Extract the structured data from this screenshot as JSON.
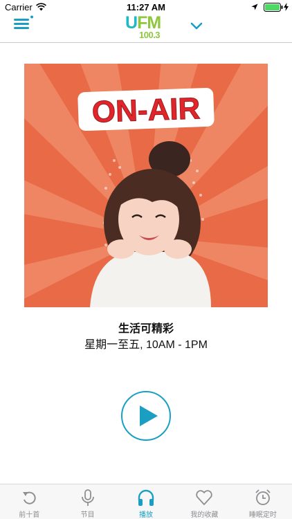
{
  "status_bar": {
    "carrier": "Carrier",
    "time": "11:27 AM"
  },
  "header": {
    "logo_main_u": "U",
    "logo_main_fm": "FM",
    "logo_frequency": "100.3",
    "dropdown_icon": "chevron-down-icon",
    "menu_icon": "hamburger-menu-icon"
  },
  "now_playing": {
    "cover_badge": "ON-AIR",
    "show_title": "生活可精彩",
    "schedule": "星期一至五, 10AM - 1PM",
    "play_icon": "play-icon"
  },
  "tab_bar": {
    "items": [
      {
        "label": "前十首",
        "icon": "replay-icon",
        "active": false
      },
      {
        "label": "节目",
        "icon": "microphone-icon",
        "active": false
      },
      {
        "label": "播放",
        "icon": "headphones-icon",
        "active": true
      },
      {
        "label": "我的收藏",
        "icon": "heart-icon",
        "active": false
      },
      {
        "label": "睡眠定时",
        "icon": "alarm-clock-icon",
        "active": false
      }
    ]
  },
  "colors": {
    "accent": "#1a9fc3",
    "logo_teal": "#1fb9c4",
    "logo_green": "#8ec63f",
    "cover_background": "#e96a47",
    "tab_inactive": "#8e8e93"
  }
}
